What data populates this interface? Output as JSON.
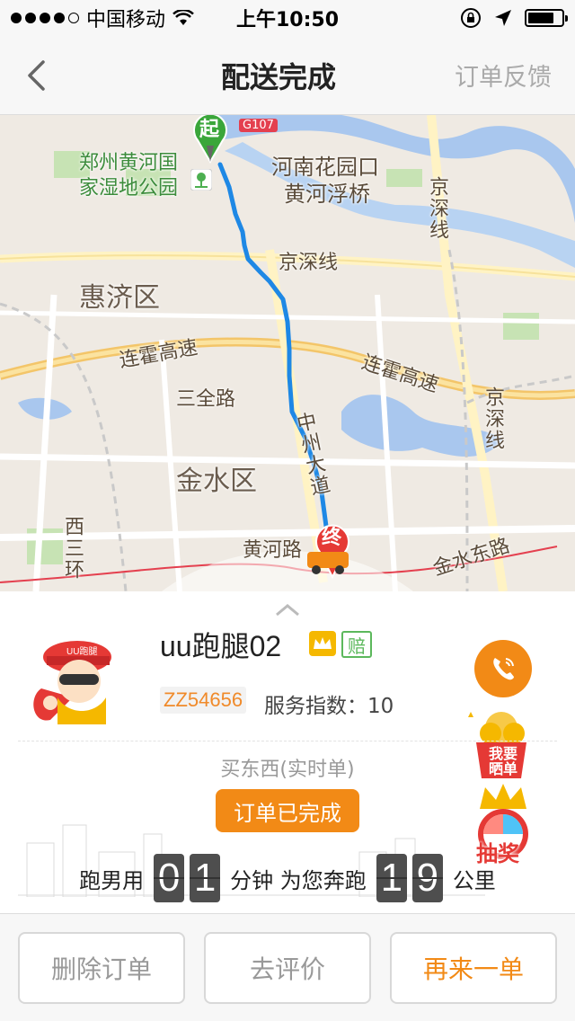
{
  "status_bar": {
    "carrier": "中国移动",
    "time": "上午10:50"
  },
  "nav": {
    "title": "配送完成",
    "right_action": "订单反馈"
  },
  "map": {
    "labels": {
      "park": "郑州黄河国家湿地公园",
      "bridge_line1": "河南花园口",
      "bridge_line2": "黄河浮桥",
      "jingshen_vert_1": "京深线",
      "jingshen_h": "京深线",
      "huiji": "惠济区",
      "lianhuo_left": "连霍高速",
      "lianhuo_right": "连霍高速",
      "sanquan": "三全路",
      "jingshen_vert_2": "京深线",
      "zhongzhou": "中州大道",
      "jinshui": "金水区",
      "huanghe_road": "黄河路",
      "jinshui_east": "金水东路",
      "xisanhuan": "西三环",
      "g107": "G107"
    },
    "start_marker": "起",
    "end_marker": "终"
  },
  "driver": {
    "name": "uu跑腿02",
    "badge": "赔",
    "code": "ZZ54656",
    "service_index": "服务指数：10"
  },
  "order": {
    "type": "买东西(实时单)",
    "status": "订单已完成",
    "stats_prefix": "跑男用",
    "minutes_digits": [
      "0",
      "1"
    ],
    "minutes_unit": "分钟 为您奔跑",
    "km_digits": [
      "1",
      "9"
    ],
    "km_unit": "公里"
  },
  "promos": {
    "share": "我要晒单",
    "lottery": "抽奖"
  },
  "actions": {
    "delete": "删除订单",
    "review": "去评价",
    "reorder": "再来一单"
  },
  "colors": {
    "accent": "#f28a16",
    "route": "#1e88e5",
    "badge_green": "#5cb85c"
  },
  "icons": [
    "signal-dots-icon",
    "wifi-icon",
    "lock-rotation-icon",
    "location-arrow-icon",
    "battery-icon",
    "back-chevron-icon",
    "start-pin-icon",
    "end-pin-icon",
    "crown-icon",
    "phone-icon",
    "chevron-up-icon"
  ]
}
